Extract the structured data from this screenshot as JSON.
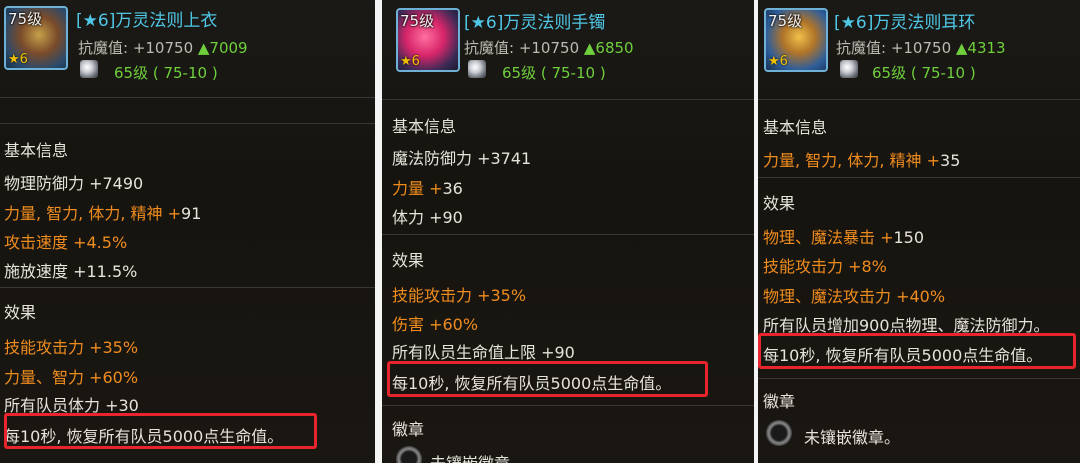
{
  "items": [
    {
      "icon_name": "armor-icon",
      "level_badge": "75级",
      "star_badge": "6",
      "title": "[★6]万灵法则上衣",
      "resist_label": "抗魔值: +10750",
      "resist_bonus": "▲7009",
      "level_req": "65级 ( 75-10 )",
      "basic_header": "基本信息",
      "basic": [
        {
          "text": "物理防御力 +7490"
        },
        {
          "name": "力量, 智力, 体力, 精神 +",
          "value": "91"
        },
        {
          "name": "攻击速度 +",
          "value": "4.5%"
        },
        {
          "text": "施放速度 +11.5%"
        }
      ],
      "effect_header": "效果",
      "effects": [
        {
          "name": "技能攻击力 +",
          "value": "35%"
        },
        {
          "name": "力量、智力 +",
          "value": "60%"
        },
        {
          "text": "所有队员体力 +30"
        },
        {
          "text": "每10秒, 恢复所有队员5000点生命值。"
        }
      ]
    },
    {
      "icon_name": "bracelet-icon",
      "level_badge": "75级",
      "star_badge": "6",
      "title": "[★6]万灵法则手镯",
      "resist_label": "抗魔值: +10750",
      "resist_bonus": "▲6850",
      "level_req": "65级 ( 75-10 )",
      "basic_header": "基本信息",
      "basic": [
        {
          "text": "魔法防御力 +3741"
        },
        {
          "name": "力量 +",
          "value": "36"
        },
        {
          "text": "体力 +90"
        }
      ],
      "effect_header": "效果",
      "effects": [
        {
          "name": "技能攻击力 +",
          "value": "35%"
        },
        {
          "name": "伤害 +",
          "value": "60%"
        },
        {
          "text": "所有队员生命值上限 +90"
        },
        {
          "text": "每10秒, 恢复所有队员5000点生命值。"
        }
      ],
      "emblem_header": "徽章",
      "emblem_text": "未镶嵌徽章"
    },
    {
      "icon_name": "earring-icon",
      "level_badge": "75级",
      "star_badge": "6",
      "title": "[★6]万灵法则耳环",
      "resist_label": "抗魔值: +10750",
      "resist_bonus": "▲4313",
      "level_req": "65级 ( 75-10 )",
      "basic_header": "基本信息",
      "basic": [
        {
          "name": "力量, 智力, 体力, 精神 +",
          "value": "35"
        }
      ],
      "effect_header": "效果",
      "effects": [
        {
          "name": "物理、魔法暴击 +",
          "value": "150"
        },
        {
          "name": "技能攻击力 +",
          "value": "8%"
        },
        {
          "name": "物理、魔法攻击力 +",
          "value": "40%"
        },
        {
          "text": "所有队员增加900点物理、魔法防御力。"
        },
        {
          "text": "每10秒, 恢复所有队员5000点生命值。"
        }
      ],
      "emblem_header": "徽章",
      "emblem_text": "未镶嵌徽章。"
    }
  ],
  "colors": {
    "title": "#4fc8e8",
    "bonus": "#6fcf3c",
    "orange": "#f08c1e",
    "highlight": "#e8242c"
  }
}
